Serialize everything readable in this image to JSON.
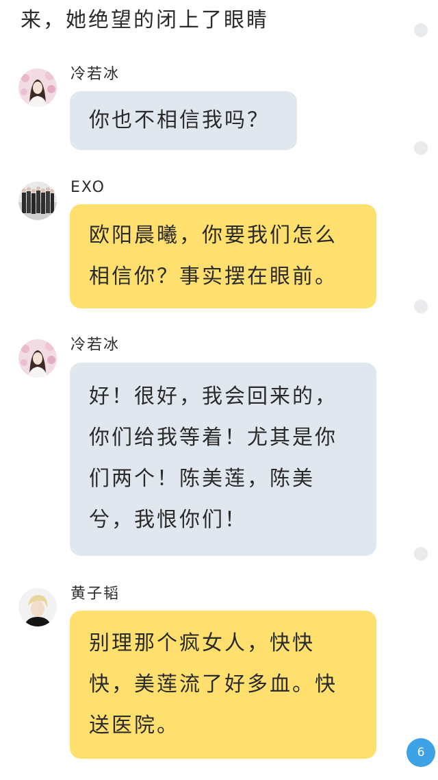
{
  "narration": "来，她绝望的闭上了眼睛",
  "messages": [
    {
      "sender": "冷若冰",
      "avatar_icon": "girl-portrait-avatar",
      "bubble_color": "#e1e7ef",
      "text": "你也不相信我吗？"
    },
    {
      "sender": "EXO",
      "avatar_icon": "group-photo-avatar",
      "bubble_color": "#ffe06f",
      "text": "欧阳晨曦，你要我们怎么\n相信你？事实摆在眼前。"
    },
    {
      "sender": "冷若冰",
      "avatar_icon": "girl-portrait-avatar",
      "bubble_color": "#e1e7ef",
      "text": "好！很好，我会回来的，\n你们给我等着！尤其是你\n们两个！陈美莲，陈美\n兮，我恨你们！"
    },
    {
      "sender": "黄子韬",
      "avatar_icon": "boy-portrait-avatar",
      "bubble_color": "#ffe06f",
      "text": "别理那个疯女人，快快\n快，美莲流了好多血。快\n送医院。"
    }
  ],
  "page_badge": "6",
  "colors": {
    "badge": "#3ea2e6",
    "dot": "#e9eaec"
  }
}
